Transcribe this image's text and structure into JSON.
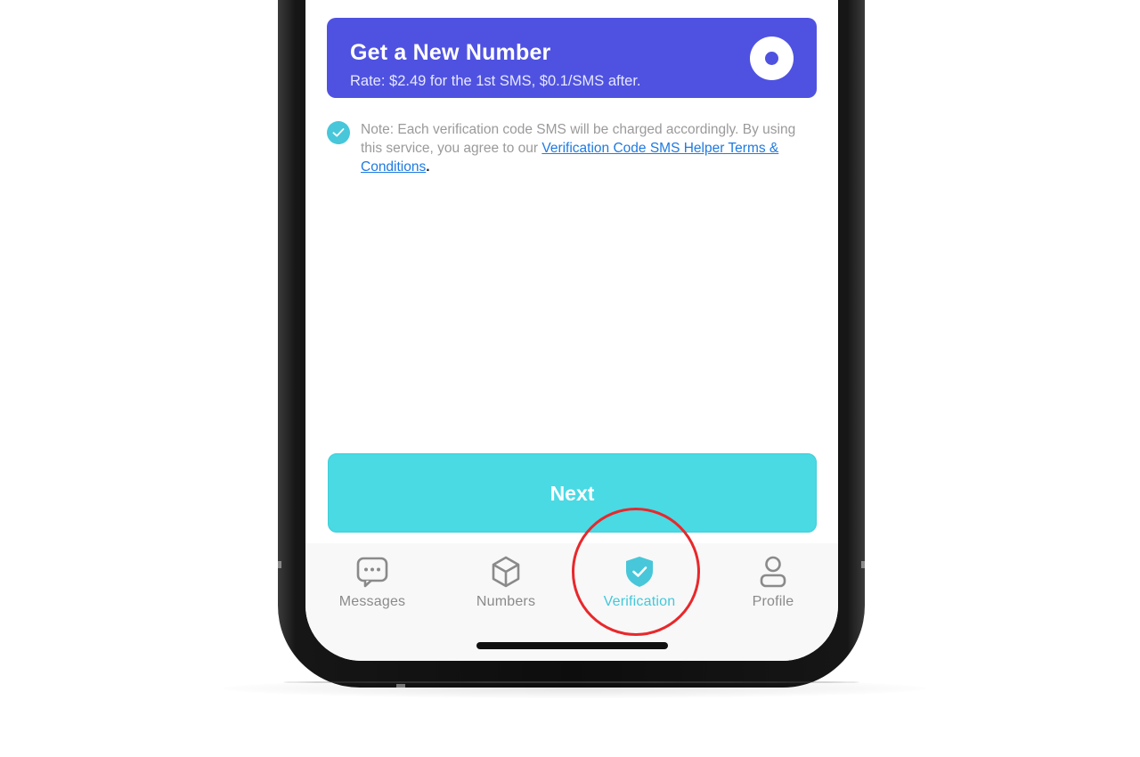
{
  "plan_card": {
    "title": "Get a New Number",
    "rate": "Rate: $2.49 for the 1st SMS, $0.1/SMS after.",
    "selected": true
  },
  "note": {
    "checked": true,
    "text_line_1": "Note: Each verification code SMS will be charged accordingly.",
    "text_prefix": "By using this service, you agree to our",
    "link_text": "Verification Code SMS Helper Terms & Conditions",
    "period": "."
  },
  "next_button": {
    "label": "Next"
  },
  "tab_bar": {
    "active": "Verification",
    "tabs": [
      {
        "label": "Messages",
        "icon": "message-bubble-icon"
      },
      {
        "label": "Numbers",
        "icon": "box-icon"
      },
      {
        "label": "Verification",
        "icon": "shield-check-icon"
      },
      {
        "label": "Profile",
        "icon": "person-icon"
      }
    ]
  },
  "colors": {
    "card": "#4f52e0",
    "accent": "#47c7d9",
    "next_button": "#49dae4",
    "link": "#1f7ae0",
    "highlight": "#e8282c",
    "inactive_tab": "#8a8a8a"
  }
}
